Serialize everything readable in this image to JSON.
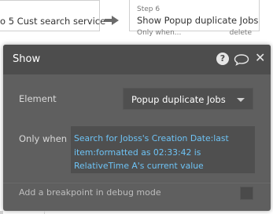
{
  "workflow": {
    "prev_step": {
      "title": "o 5 Cust search service"
    },
    "step": {
      "number": "Step 6",
      "title": "Show Popup duplicate Jobs",
      "show_when": "Only when...",
      "delete": "delete"
    }
  },
  "panel": {
    "title": "Show",
    "element": {
      "label": "Element",
      "value": "Popup duplicate Jobs"
    },
    "only_when": {
      "label": "Only when",
      "expression": "Search for Jobss's Creation Date:last item:formatted as 02:33:42 is RelativeTime A's current value"
    },
    "breakpoint": {
      "label": "Add a breakpoint in debug mode",
      "checked": false
    },
    "icons": [
      "help-icon",
      "comment-icon",
      "close-icon"
    ]
  },
  "colors": {
    "panel_bg": "#5f5f5f",
    "header_bg": "#4d4d4d",
    "expression_text": "#6ec3f5"
  }
}
